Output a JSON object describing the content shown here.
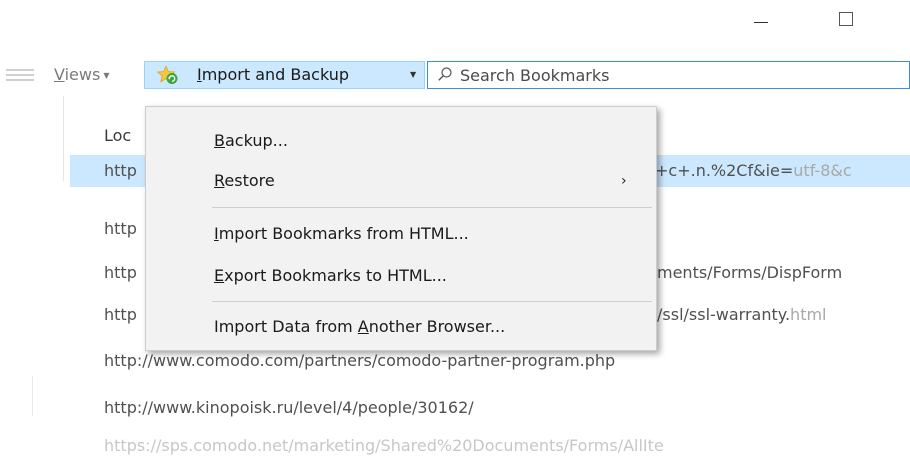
{
  "window": {
    "minimize_icon": "minimize-icon",
    "maximize_icon": "maximize-icon"
  },
  "toolbar": {
    "views_label_u": "V",
    "views_label_rest": "iews",
    "import_label_u": "I",
    "import_label_rest": "mport and Backup",
    "search_placeholder": "Search Bookmarks",
    "search_value": ""
  },
  "table": {
    "column_header": "Loc",
    "rows": [
      "http",
      "http",
      "http",
      "http",
      "http://www.comodo.com/partners/comodo-partner-program.php",
      "http://www.kinopoisk.ru/level/4/people/30162/",
      "https://sps.comodo.net/marketing/Shared%20Documents/Forms/AllIte"
    ],
    "row1_right_dark": "+c+.n.%2Cf&ie=",
    "row1_right_dim": "utf-8&c",
    "row3_right": "ments/Forms/DispForm",
    "row4_right_dark": "/ssl/ssl-warranty.",
    "row4_right_dim": "html"
  },
  "menu": {
    "items": [
      {
        "u": "B",
        "rest": "ackup..."
      },
      {
        "u": "R",
        "rest": "estore",
        "submenu_arrow": "›"
      },
      {
        "u": "I",
        "rest": "mport Bookmarks from HTML..."
      },
      {
        "u": "E",
        "rest": "xport Bookmarks to HTML..."
      },
      {
        "pre": "Import Data from ",
        "u": "A",
        "rest": "nother Browser..."
      }
    ]
  }
}
